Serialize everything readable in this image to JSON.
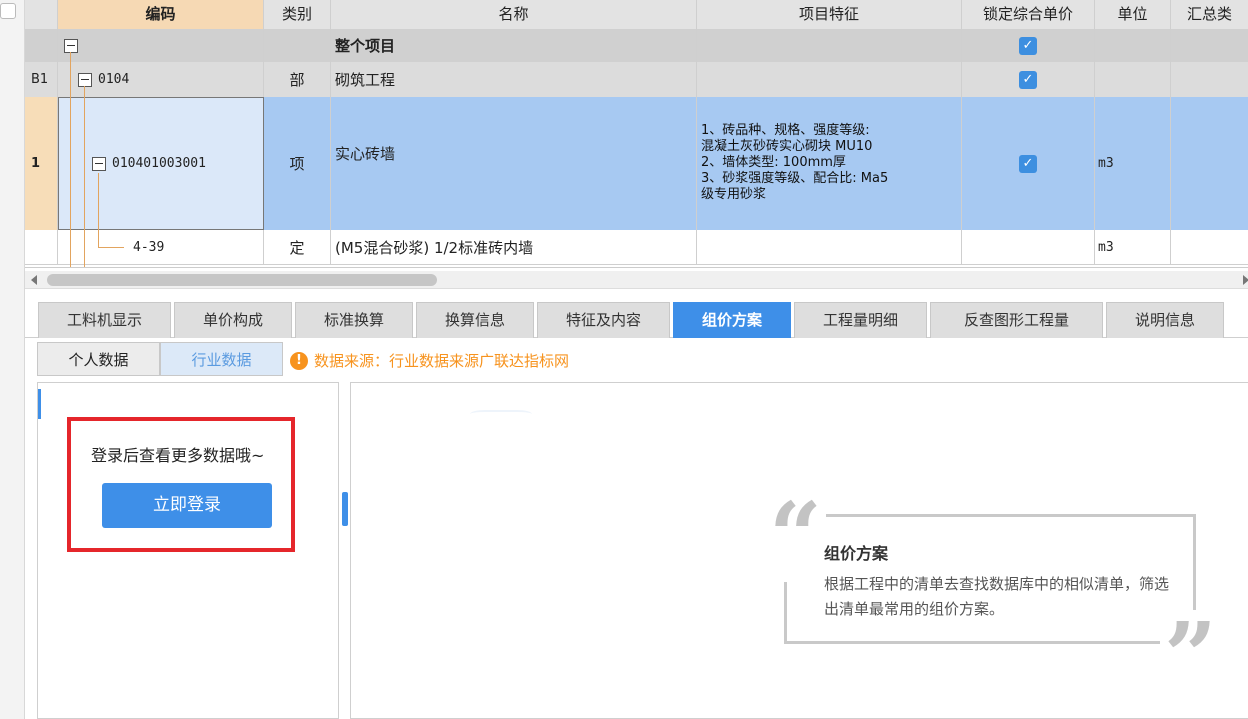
{
  "grid": {
    "headers": {
      "code": "编码",
      "category": "类别",
      "name": "名称",
      "features": "项目特征",
      "lock_price": "锁定综合单价",
      "unit": "单位",
      "summary": "汇总类"
    },
    "rows": [
      {
        "rownum": "",
        "code": "",
        "category": "",
        "name": "整个项目",
        "features": [],
        "locked": true,
        "unit": ""
      },
      {
        "rownum": "B1",
        "code": "0104",
        "category": "部",
        "name": "砌筑工程",
        "features": [],
        "locked": true,
        "unit": ""
      },
      {
        "rownum": "1",
        "code": "010401003001",
        "category": "项",
        "name": "实心砖墙",
        "features": [
          "1、砖品种、规格、强度等级:",
          "混凝土灰砂砖实心砌块 MU10",
          "2、墙体类型: 100mm厚",
          "3、砂浆强度等级、配合比: Ma5",
          "级专用砂浆"
        ],
        "locked": true,
        "unit": "m3"
      },
      {
        "rownum": "",
        "code": "4-39",
        "category": "定",
        "name": "(M5混合砂浆) 1/2标准砖内墙",
        "features": [],
        "locked": false,
        "unit": "m3"
      }
    ]
  },
  "tabs": [
    {
      "label": "工料机显示",
      "active": false
    },
    {
      "label": "单价构成",
      "active": false
    },
    {
      "label": "标准换算",
      "active": false
    },
    {
      "label": "换算信息",
      "active": false
    },
    {
      "label": "特征及内容",
      "active": false
    },
    {
      "label": "组价方案",
      "active": true
    },
    {
      "label": "工程量明细",
      "active": false
    },
    {
      "label": "反查图形工程量",
      "active": false
    },
    {
      "label": "说明信息",
      "active": false
    }
  ],
  "subtabs": {
    "personal": "个人数据",
    "industry": "行业数据",
    "source_icon": "!",
    "source_text": "数据来源：行业数据来源广联达指标网"
  },
  "login": {
    "tip": "登录后查看更多数据哦~",
    "button": "立即登录"
  },
  "quote": {
    "open_mark": "“",
    "close_mark": "”",
    "title": "组价方案",
    "body": "根据工程中的清单去查找数据库中的相似清单，筛选出清单最常用的组价方案。"
  },
  "icons": {
    "check": "✓",
    "accent_color": "#3e8fe8",
    "warning_color": "#f7931e",
    "highlight_color": "#e5262b"
  }
}
